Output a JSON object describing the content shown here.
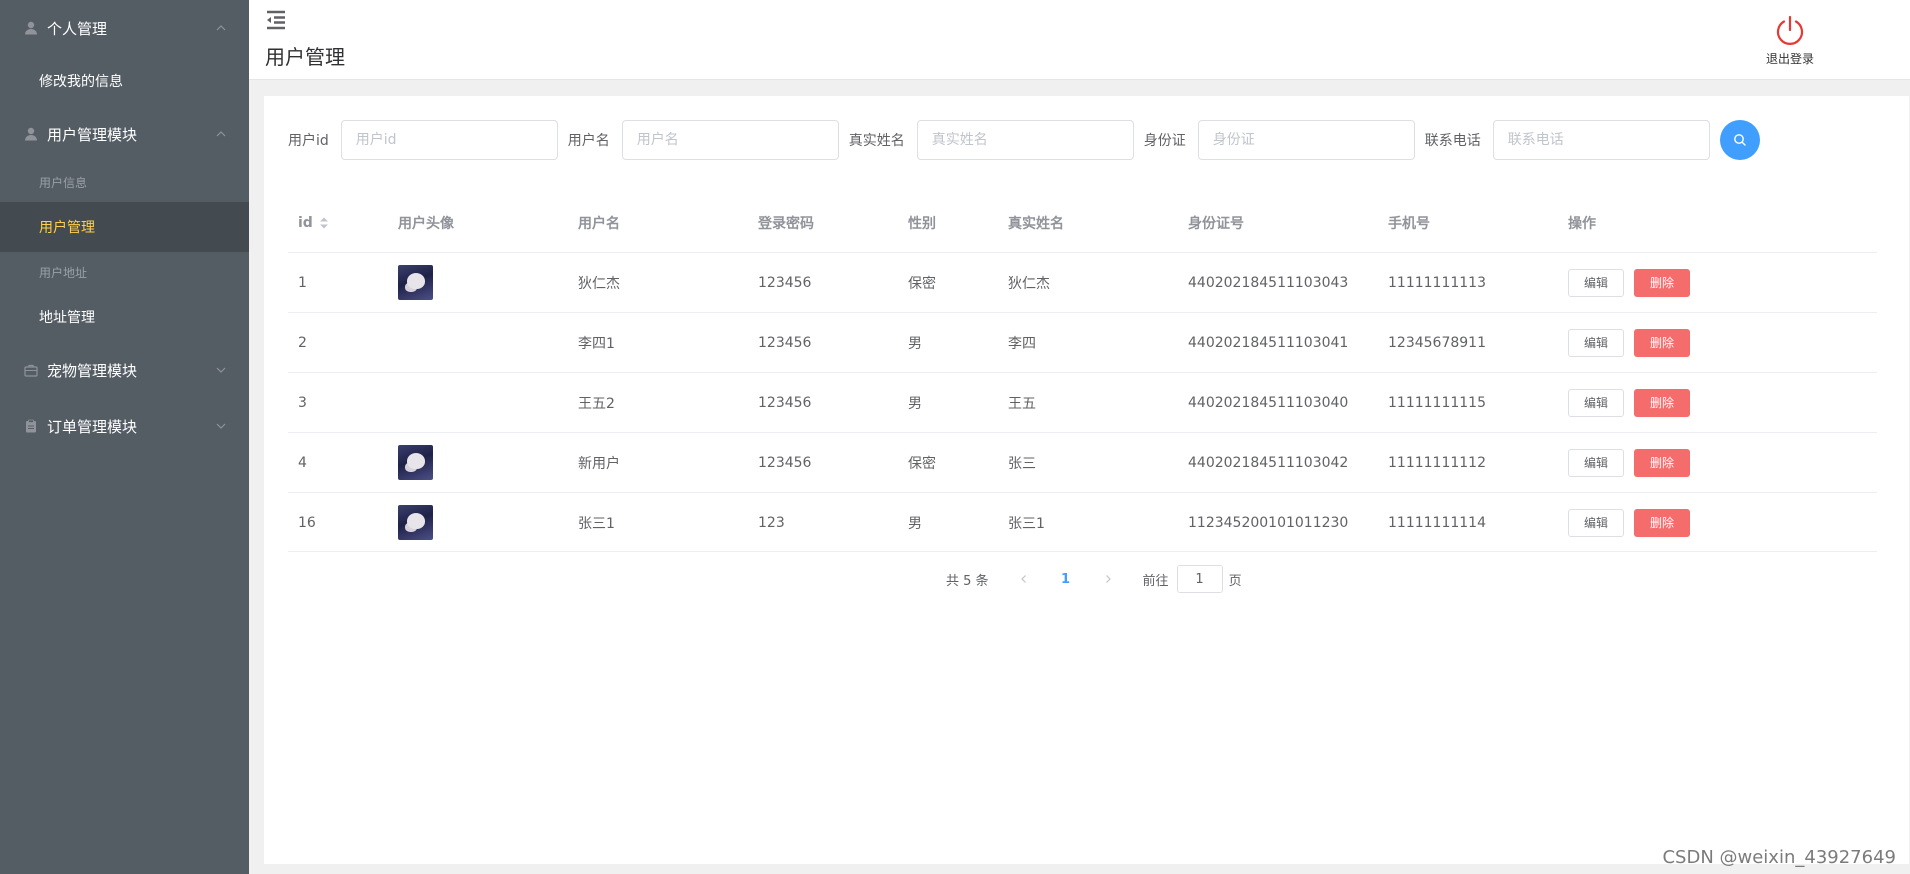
{
  "sidebar": {
    "groups": [
      {
        "label": "个人管理",
        "icon": "user-icon",
        "expanded": true,
        "items": [
          {
            "label": "修改我的信息"
          }
        ]
      },
      {
        "label": "用户管理模块",
        "icon": "user-icon",
        "expanded": true,
        "sections": [
          {
            "label": "用户信息",
            "items": [
              {
                "label": "用户管理",
                "active": true
              }
            ]
          },
          {
            "label": "用户地址",
            "items": [
              {
                "label": "地址管理"
              }
            ]
          }
        ]
      },
      {
        "label": "宠物管理模块",
        "icon": "briefcase-icon",
        "expanded": false
      },
      {
        "label": "订单管理模块",
        "icon": "clipboard-icon",
        "expanded": false
      }
    ]
  },
  "header": {
    "title": "用户管理",
    "logout_label": "退出登录"
  },
  "search": {
    "fields": [
      {
        "label": "用户id",
        "placeholder": "用户id",
        "value": ""
      },
      {
        "label": "用户名",
        "placeholder": "用户名",
        "value": ""
      },
      {
        "label": "真实姓名",
        "placeholder": "真实姓名",
        "value": ""
      },
      {
        "label": "身份证",
        "placeholder": "身份证",
        "value": ""
      },
      {
        "label": "联系电话",
        "placeholder": "联系电话",
        "value": ""
      }
    ]
  },
  "table": {
    "columns": [
      "id",
      "用户头像",
      "用户名",
      "登录密码",
      "性别",
      "真实姓名",
      "身份证号",
      "手机号",
      "操作"
    ],
    "rows": [
      {
        "id": "1",
        "has_avatar": true,
        "username": "狄仁杰",
        "password": "123456",
        "sex": "保密",
        "realname": "狄仁杰",
        "idcard": "440202184511103043",
        "phone": "11111111113"
      },
      {
        "id": "2",
        "has_avatar": false,
        "username": "李四1",
        "password": "123456",
        "sex": "男",
        "realname": "李四",
        "idcard": "440202184511103041",
        "phone": "12345678911"
      },
      {
        "id": "3",
        "has_avatar": false,
        "username": "王五2",
        "password": "123456",
        "sex": "男",
        "realname": "王五",
        "idcard": "440202184511103040",
        "phone": "11111111115"
      },
      {
        "id": "4",
        "has_avatar": true,
        "username": "新用户",
        "password": "123456",
        "sex": "保密",
        "realname": "张三",
        "idcard": "440202184511103042",
        "phone": "11111111112"
      },
      {
        "id": "16",
        "has_avatar": true,
        "username": "张三1",
        "password": "123",
        "sex": "男",
        "realname": "张三1",
        "idcard": "112345200101011230",
        "phone": "11111111114"
      }
    ],
    "edit_label": "编辑",
    "delete_label": "删除"
  },
  "pagination": {
    "total_text": "共 5 条",
    "current_page": "1",
    "goto_label": "前往",
    "goto_value": "1",
    "page_suffix": "页"
  },
  "watermark": "CSDN @weixin_43927649",
  "colors": {
    "sidebar_bg": "#545c64",
    "active_text": "#ffd04b",
    "primary": "#409eff",
    "danger": "#f56c6c",
    "logout_icon": "#e53935"
  }
}
